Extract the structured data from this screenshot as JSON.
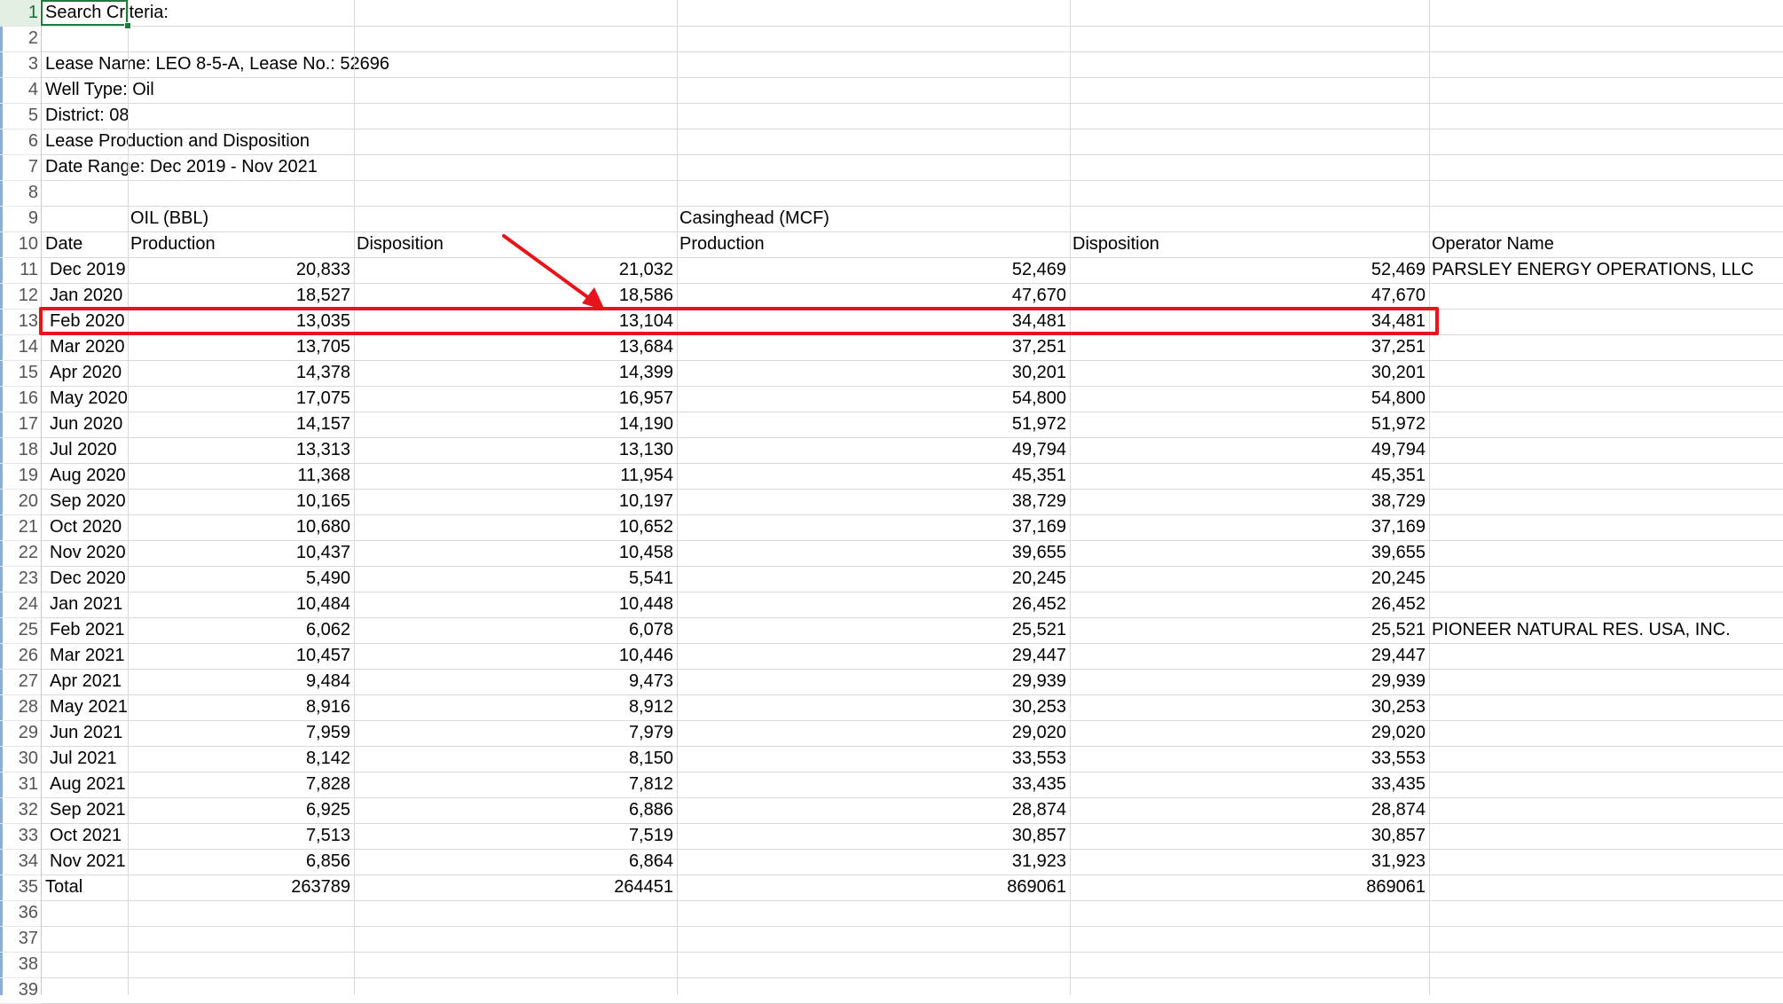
{
  "rows": [
    {
      "n": "1",
      "a": "Search Criteria:"
    },
    {
      "n": "2"
    },
    {
      "n": "3",
      "a": "Lease Name: LEO 8-5-A, Lease No.: 52696"
    },
    {
      "n": "4",
      "a": "Well Type: Oil"
    },
    {
      "n": "5",
      "a": "District: 08"
    },
    {
      "n": "6",
      "a": "Lease Production and Disposition"
    },
    {
      "n": "7",
      "a": "Date Range: Dec 2019 - Nov 2021"
    },
    {
      "n": "8"
    },
    {
      "n": "9",
      "b": "OIL (BBL)",
      "d": "Casinghead (MCF)"
    },
    {
      "n": "10",
      "a": "Date",
      "b": "Production",
      "c": "Disposition",
      "d": "Production",
      "e": "Disposition",
      "f": "Operator Name"
    },
    {
      "n": "11",
      "a": "Dec 2019",
      "b": "20,833",
      "c": "21,032",
      "d": "52,469",
      "e": "52,469",
      "f": "PARSLEY ENERGY OPERATIONS, LLC"
    },
    {
      "n": "12",
      "a": "Jan 2020",
      "b": "18,527",
      "c": "18,586",
      "d": "47,670",
      "e": "47,670"
    },
    {
      "n": "13",
      "a": "Feb 2020",
      "b": "13,035",
      "c": "13,104",
      "d": "34,481",
      "e": "34,481"
    },
    {
      "n": "14",
      "a": "Mar 2020",
      "b": "13,705",
      "c": "13,684",
      "d": "37,251",
      "e": "37,251"
    },
    {
      "n": "15",
      "a": "Apr 2020",
      "b": "14,378",
      "c": "14,399",
      "d": "30,201",
      "e": "30,201"
    },
    {
      "n": "16",
      "a": "May 2020",
      "b": "17,075",
      "c": "16,957",
      "d": "54,800",
      "e": "54,800"
    },
    {
      "n": "17",
      "a": "Jun 2020",
      "b": "14,157",
      "c": "14,190",
      "d": "51,972",
      "e": "51,972"
    },
    {
      "n": "18",
      "a": "Jul 2020",
      "b": "13,313",
      "c": "13,130",
      "d": "49,794",
      "e": "49,794"
    },
    {
      "n": "19",
      "a": "Aug 2020",
      "b": "11,368",
      "c": "11,954",
      "d": "45,351",
      "e": "45,351"
    },
    {
      "n": "20",
      "a": "Sep 2020",
      "b": "10,165",
      "c": "10,197",
      "d": "38,729",
      "e": "38,729"
    },
    {
      "n": "21",
      "a": "Oct 2020",
      "b": "10,680",
      "c": "10,652",
      "d": "37,169",
      "e": "37,169"
    },
    {
      "n": "22",
      "a": "Nov 2020",
      "b": "10,437",
      "c": "10,458",
      "d": "39,655",
      "e": "39,655"
    },
    {
      "n": "23",
      "a": "Dec 2020",
      "b": "5,490",
      "c": "5,541",
      "d": "20,245",
      "e": "20,245"
    },
    {
      "n": "24",
      "a": "Jan 2021",
      "b": "10,484",
      "c": "10,448",
      "d": "26,452",
      "e": "26,452"
    },
    {
      "n": "25",
      "a": "Feb 2021",
      "b": "6,062",
      "c": "6,078",
      "d": "25,521",
      "e": "25,521",
      "f": "PIONEER NATURAL RES. USA, INC."
    },
    {
      "n": "26",
      "a": "Mar 2021",
      "b": "10,457",
      "c": "10,446",
      "d": "29,447",
      "e": "29,447"
    },
    {
      "n": "27",
      "a": "Apr 2021",
      "b": "9,484",
      "c": "9,473",
      "d": "29,939",
      "e": "29,939"
    },
    {
      "n": "28",
      "a": "May 2021",
      "b": "8,916",
      "c": "8,912",
      "d": "30,253",
      "e": "30,253"
    },
    {
      "n": "29",
      "a": "Jun 2021",
      "b": "7,959",
      "c": "7,979",
      "d": "29,020",
      "e": "29,020"
    },
    {
      "n": "30",
      "a": "Jul 2021",
      "b": "8,142",
      "c": "8,150",
      "d": "33,553",
      "e": "33,553"
    },
    {
      "n": "31",
      "a": "Aug 2021",
      "b": "7,828",
      "c": "7,812",
      "d": "33,435",
      "e": "33,435"
    },
    {
      "n": "32",
      "a": "Sep 2021",
      "b": "6,925",
      "c": "6,886",
      "d": "28,874",
      "e": "28,874"
    },
    {
      "n": "33",
      "a": "Oct 2021",
      "b": "7,513",
      "c": "7,519",
      "d": "30,857",
      "e": "30,857"
    },
    {
      "n": "34",
      "a": "Nov 2021",
      "b": "6,856",
      "c": "6,864",
      "d": "31,923",
      "e": "31,923"
    },
    {
      "n": "35",
      "a": "Total",
      "b": "263789",
      "c": "264451",
      "d": "869061",
      "e": "869061"
    },
    {
      "n": "36"
    },
    {
      "n": "37"
    },
    {
      "n": "38"
    },
    {
      "n": "39"
    }
  ],
  "annotation": {
    "highlight_color": "#e8141b"
  },
  "selection": {
    "active_row": "1",
    "color": "#1f7a3f"
  }
}
